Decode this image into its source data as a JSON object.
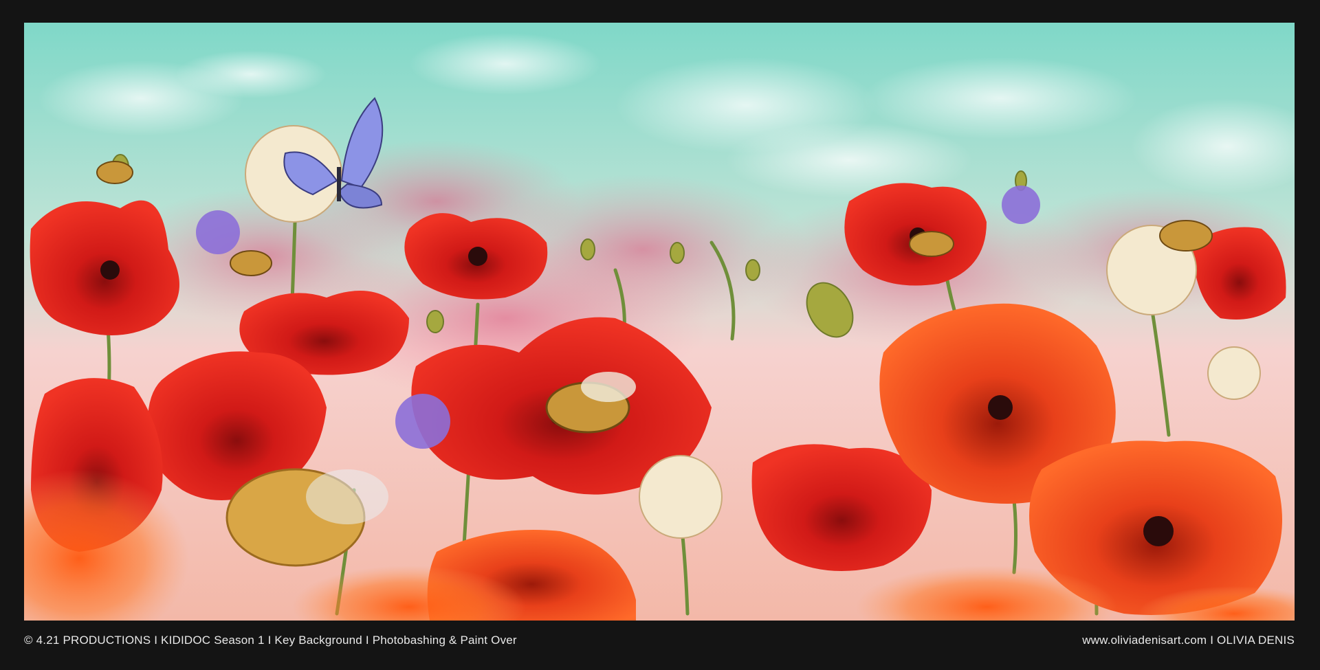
{
  "artwork": {
    "subject": "poppy-field-with-bees-and-butterfly-illustration",
    "palette": {
      "frame": "#141414",
      "sky_top": "#7fd8c8",
      "sky_bottom": "#f6d2cf",
      "poppy_red": "#e3201b",
      "poppy_orange": "#f0561c",
      "cornflower": "#8c6fd8",
      "butterfly": "#8c93e6",
      "bee_gold": "#c9973a",
      "stem_green": "#6f8f3a",
      "paper_cream": "#f4e9cf"
    }
  },
  "caption": {
    "left": "© 4.21 PRODUCTIONS  I  KIDIDOC Season 1  I  Key Background  I Photobashing & Paint Over",
    "right": "www.oliviadenisart.com  I  OLIVIA DENIS"
  }
}
